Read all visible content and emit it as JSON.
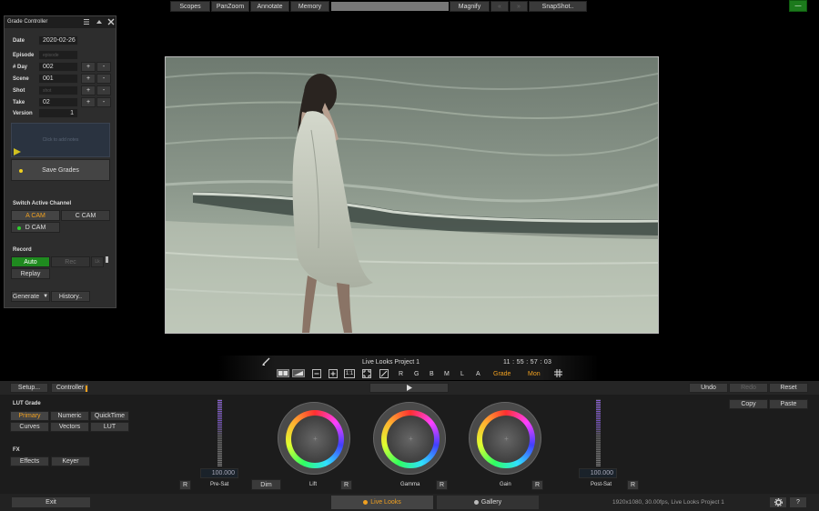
{
  "topbar": {
    "scopes": "Scopes",
    "panzoom": "PanZoom",
    "annotate": "Annotate",
    "memory": "Memory",
    "magnify": "Magnify",
    "arrow_left": "«",
    "arrow_right": "»",
    "snapshot": "SnapShot..",
    "minimize": "—"
  },
  "grade_controller": {
    "title": "Grade Controller",
    "date_label": "Date",
    "date_value": "2020-02-26",
    "episode_label": "Episode",
    "episode_placeholder": "episode",
    "day_label": "# Day",
    "day_value": "002",
    "scene_label": "Scene",
    "scene_value": "001",
    "shot_label": "Shot",
    "shot_placeholder": "shot",
    "take_label": "Take",
    "take_value": "02",
    "version_label": "Version",
    "version_value": "1",
    "plus": "+",
    "minus": "-",
    "notes_placeholder": "Click to add notes",
    "save_grades": "Save Grades",
    "switch_channel_title": "Switch Active Channel",
    "a_cam": "A CAM",
    "c_cam": "C CAM",
    "d_cam": "D CAM",
    "record_title": "Record",
    "auto": "Auto",
    "rec": "Rec",
    "lock": "Lk",
    "replay": "Replay",
    "generate": "Generate",
    "history": "History.."
  },
  "viewer": {
    "project_name": "Live Looks Project 1",
    "timecode": "11 : 55 : 57 : 03",
    "ch_r": "R",
    "ch_g": "G",
    "ch_b": "B",
    "ch_m": "M",
    "ch_l": "L",
    "ch_a": "A",
    "grade": "Grade",
    "mon": "Mon",
    "one_to_one": "1:1"
  },
  "controls": {
    "setup": "Setup...",
    "controller": "Controller",
    "undo": "Undo",
    "redo": "Redo",
    "reset": "Reset",
    "copy": "Copy",
    "paste": "Paste",
    "lut_grade_title": "LUT Grade",
    "primary": "Primary",
    "numeric": "Numeric",
    "quicktime": "QuickTime",
    "curves": "Curves",
    "vectors": "Vectors",
    "lut": "LUT",
    "fx_title": "FX",
    "effects": "Effects",
    "keyer": "Keyer",
    "presat_value": "100.000",
    "postsat_value": "100.000",
    "r": "R",
    "dim": "Dim",
    "presat_label": "Pre-Sat",
    "lift_label": "Lift",
    "gamma_label": "Gamma",
    "gain_label": "Gain",
    "postsat_label": "Post-Sat"
  },
  "statusbar": {
    "exit": "Exit",
    "live_looks": "Live Looks",
    "gallery": "Gallery",
    "info": "1920x1080, 30.00fps, Live Looks Project 1",
    "help": "?"
  },
  "colors": {
    "accent_orange": "#f0a020",
    "active_green": "#1f8a1f"
  }
}
